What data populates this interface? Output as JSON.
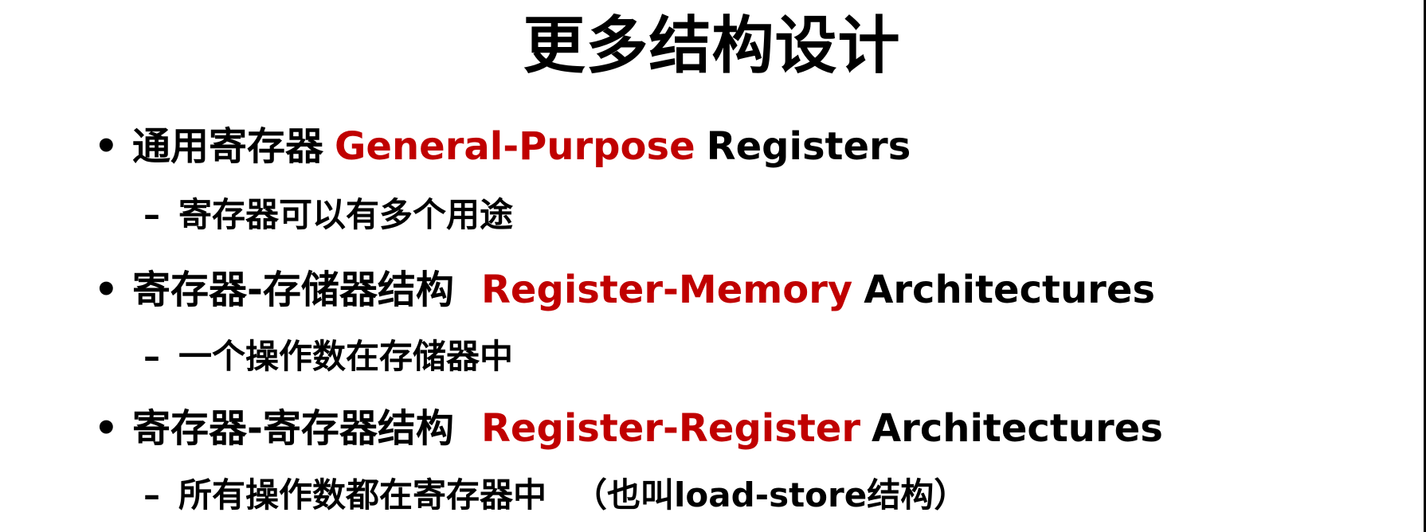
{
  "slide": {
    "title": "更多结构设计",
    "accent_color": "#c00000",
    "bullet_marker": "•",
    "sub_marker": "–",
    "items": [
      {
        "zh": "通用寄存器",
        "en_red": "General-Purpose",
        "en_black": "Registers",
        "sub": "寄存器可以有多个用途"
      },
      {
        "zh": "寄存器-存储器结构",
        "en_red": "Register-Memory",
        "en_black": "Architectures",
        "sub": "一个操作数在存储器中"
      },
      {
        "zh": "寄存器-寄存器结构",
        "en_red": "Register-Register",
        "en_black": "Architectures",
        "sub": "所有操作数都在寄存器中",
        "sub_note": "（也叫load-store结构）"
      }
    ]
  }
}
